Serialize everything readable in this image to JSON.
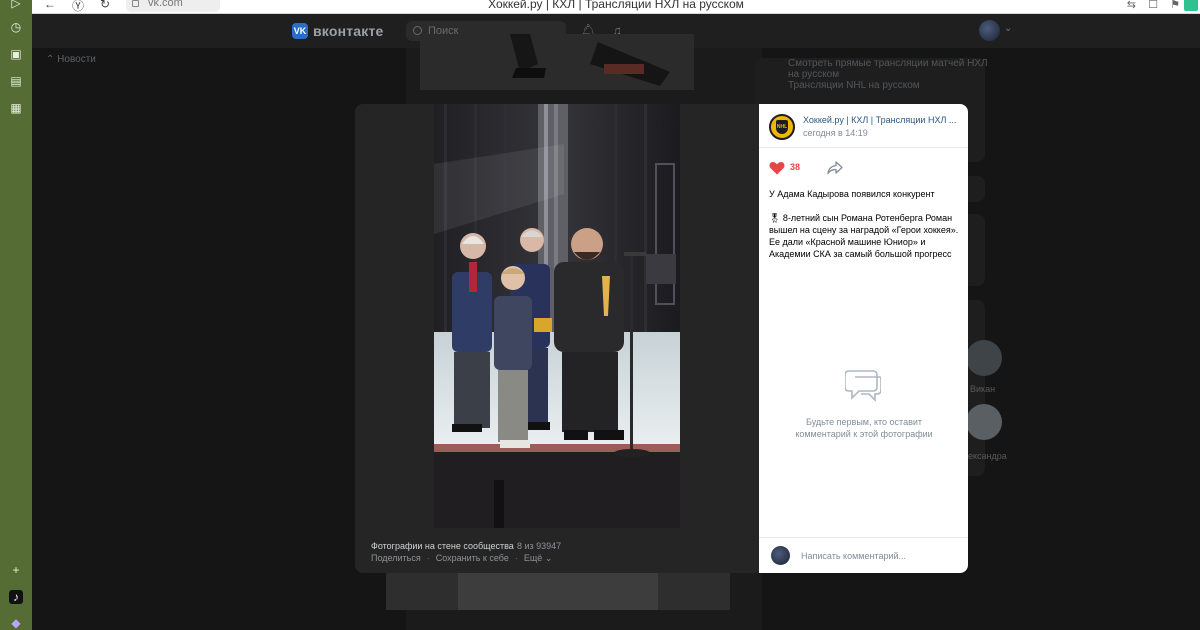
{
  "browser": {
    "url": "vk.com",
    "title": "Хоккей.ру | КХЛ | Трансляции НХЛ на русском"
  },
  "vk_header": {
    "logo_text": "вконтакте",
    "search_placeholder": "Поиск"
  },
  "left_nav": {
    "news_label": "Новости"
  },
  "right_sidebar": {
    "line1": "Смотреть прямые трансляции матчей НХЛ на русском",
    "line2": "Трансляции NHL на русском",
    "friends": [
      "Викан",
      "ександра"
    ]
  },
  "photo_viewer": {
    "caption": "Фотографии на стене сообщества",
    "counter": "8 из 93947",
    "actions": [
      "Поделиться",
      "Сохранить к себе",
      "Ещё"
    ],
    "more_chevron": "⌄"
  },
  "post": {
    "group_name": "Хоккей.ру | КХЛ | Трансляции НХЛ ...",
    "time": "сегодня в 14:19",
    "likes": "38",
    "text_title": "У Адама Кадырова появился конкурент",
    "text_body": "🎖 8-летний сын Романа Ротенберга Роман вышел на сцену за наградой «Герои хоккея». Ее дали «Красной машине Юниор» и Академии СКА за самый большой прогресс",
    "empty_comments": "Будьте первым, кто оставит комментарий к этой фотографии",
    "comment_placeholder": "Написать комментарий..."
  },
  "colors": {
    "chrome_green": "#556d34",
    "vk_blue": "#2a5885",
    "like_red": "#e64646"
  }
}
